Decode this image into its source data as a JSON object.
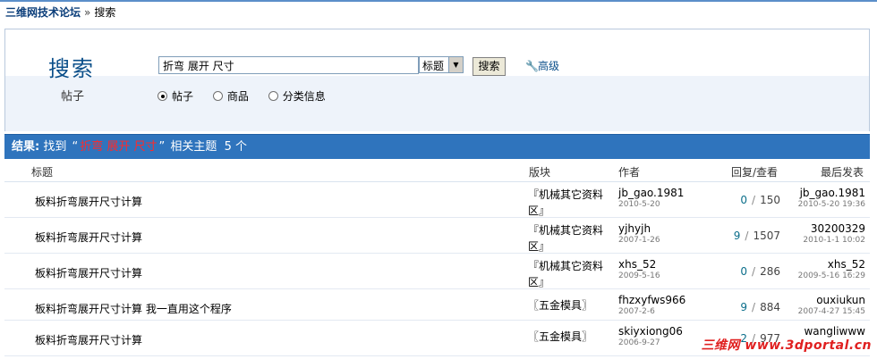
{
  "breadcrumb": {
    "home": "三维网技术论坛",
    "sep": "»",
    "current": "搜索"
  },
  "search": {
    "title": "搜索",
    "subtitle": "帖子",
    "keyword_value": "折弯 展开 尺寸",
    "scope_value": "标题",
    "button_label": "搜索",
    "advanced_label": "高级",
    "types": [
      {
        "label": "帖子",
        "checked": true
      },
      {
        "label": "商品",
        "checked": false
      },
      {
        "label": "分类信息",
        "checked": false
      }
    ]
  },
  "result": {
    "label": "结果:",
    "found": "找到",
    "open_quote": "“",
    "keyword": "折弯  展开  尺寸",
    "close_quote": "”",
    "suffix": "相关主题",
    "count": "5 个"
  },
  "table": {
    "headers": {
      "title": "标题",
      "forum": "版块",
      "author": "作者",
      "stats": "回复/查看",
      "last": "最后发表"
    },
    "rows": [
      {
        "title": "板料折弯展开尺寸计算",
        "forum": "『机械其它资料区』",
        "author": "jb_gao.1981",
        "author_date": "2010-5-20",
        "replies": "0",
        "views": "150",
        "last_user": "jb_gao.1981",
        "last_date": "2010-5-20 19:36"
      },
      {
        "title": "板料折弯展开尺寸计算",
        "forum": "『机械其它资料区』",
        "author": "yjhyjh",
        "author_date": "2007-1-26",
        "replies": "9",
        "views": "1507",
        "last_user": "30200329",
        "last_date": "2010-1-1 10:02"
      },
      {
        "title": "板料折弯展开尺寸计算",
        "forum": "『机械其它资料区』",
        "author": "xhs_52",
        "author_date": "2009-5-16",
        "replies": "0",
        "views": "286",
        "last_user": "xhs_52",
        "last_date": "2009-5-16 16:29"
      },
      {
        "title": "板料折弯展开尺寸计算  我一直用这个程序",
        "forum": "〖五金模具〗",
        "author": "fhzxyfws966",
        "author_date": "2007-2-6",
        "replies": "9",
        "views": "884",
        "last_user": "ouxiukun",
        "last_date": "2007-4-27 15:45"
      },
      {
        "title": "板料折弯展开尺寸计算",
        "forum": "〖五金模具〗",
        "author": "skiyxiong06",
        "author_date": "2006-9-27",
        "replies": "2",
        "views": "977",
        "last_user": "wangliwww",
        "last_date": ""
      }
    ]
  },
  "watermark": "三维网 www.3dportal.cn",
  "colors": {
    "result_bar": "#2f74bd",
    "keyword": "#ff2a2a",
    "link": "#0b4f8a"
  }
}
